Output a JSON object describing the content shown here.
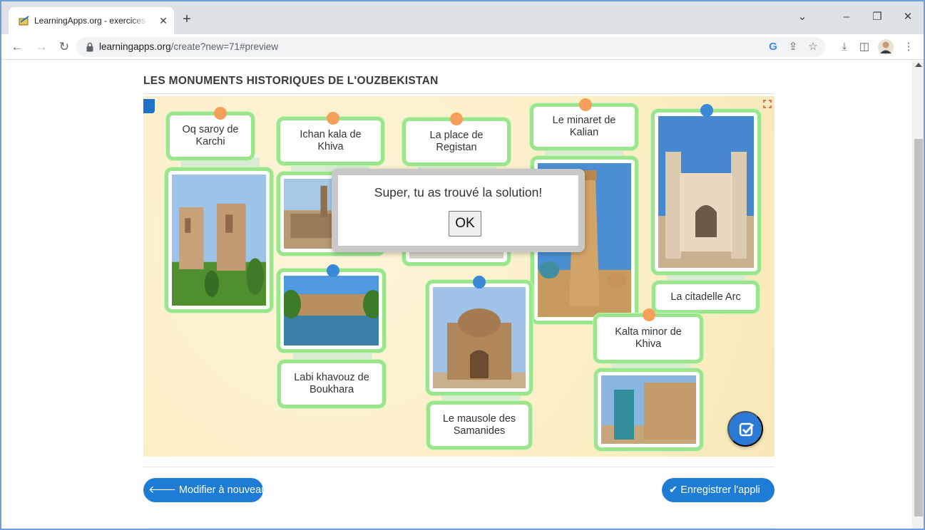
{
  "browser": {
    "tab_title": "LearningApps.org - exercices scolaires",
    "tab_close": "✕",
    "new_tab": "+",
    "url_domain": "learningapps.org",
    "url_path": "/create?new=71#preview",
    "window_controls": {
      "chevron": "⌄",
      "minimize": "–",
      "restore": "❐",
      "close": "✕"
    },
    "toolbar_icons": [
      "google-icon",
      "share-icon",
      "star-icon",
      "download-icon",
      "sidepanel-icon",
      "profile-avatar",
      "menu-icon"
    ]
  },
  "app": {
    "title": "LES MONUMENTS HISTORIQUES DE L'OUZBEKISTAN",
    "cards": [
      {
        "label": "Oq saroy de\nKarchi"
      },
      {
        "label": "Ichan kala de\nKhiva"
      },
      {
        "label": "La place de\nRegistan"
      },
      {
        "label": "Le minaret de\nKalian"
      },
      {
        "label": "La citadelle Arc"
      },
      {
        "label": "Kalta minor de\nKhiva"
      },
      {
        "label": "Labi khavouz de\nBoukhara"
      },
      {
        "label": "Le mausole des\nSamanides"
      }
    ],
    "dialog": {
      "message": "Super, tu as trouvé la solution!",
      "ok": "OK"
    },
    "buttons": {
      "modify": "Modifier à nouveau",
      "save": "Enregistrer l'appli"
    },
    "colors": {
      "accent": "#1f7cd4",
      "card_border": "#9be68c",
      "board": "#fbf0c8",
      "dot_orange": "#f5a05a",
      "dot_blue": "#3a88d8"
    }
  }
}
